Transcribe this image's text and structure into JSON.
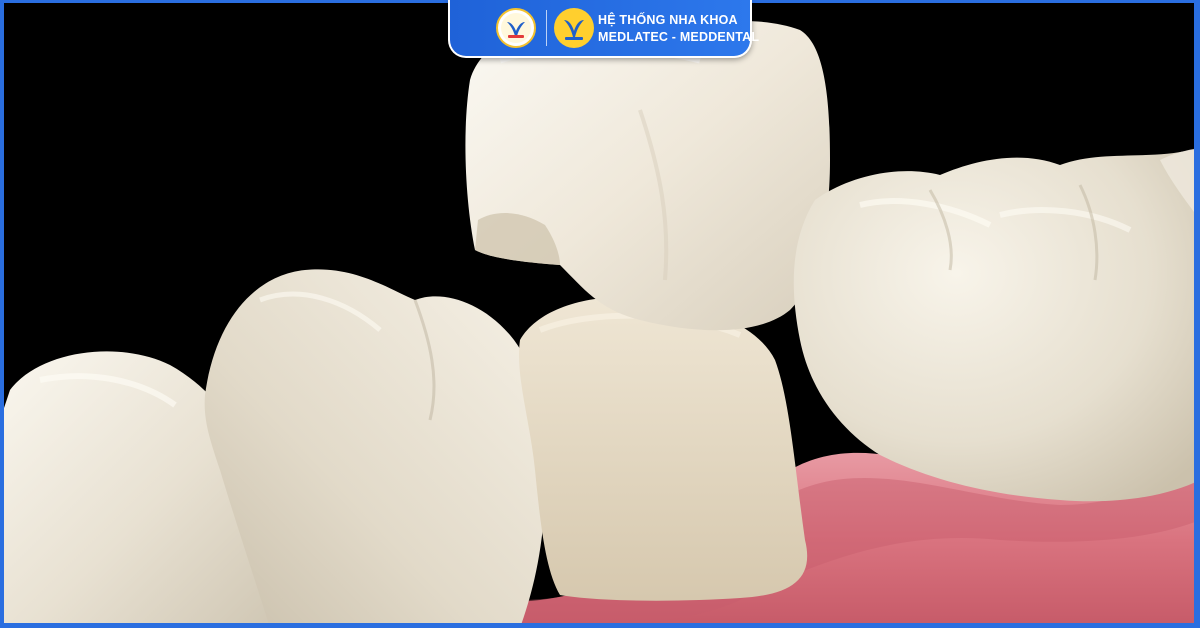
{
  "header": {
    "brand_line1": "HỆ THỐNG NHA KHOA",
    "brand_line2": "MEDLATEC - MEDDENTAL",
    "logo_left_icon": "meddental-logo-icon",
    "logo_right_icon": "medlatec-logo-icon"
  },
  "colors": {
    "badge_blue": "#2a6ee0",
    "logo_yellow": "#ffcf2e",
    "logo_blue": "#1f5fc9",
    "gum_pink": "#d9737f",
    "tooth_ivory": "#ece6d8",
    "background": "#000000"
  },
  "image": {
    "subject": "dental-crown-illustration"
  }
}
